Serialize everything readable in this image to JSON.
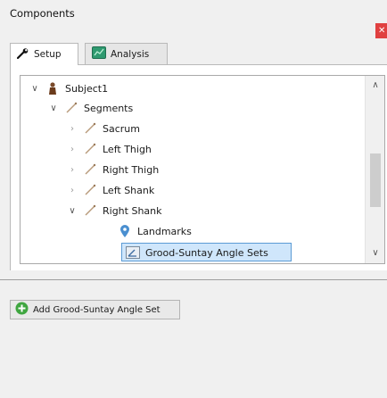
{
  "panel": {
    "title": "Components"
  },
  "tabs": [
    {
      "label": "Setup",
      "icon": "wrench-icon",
      "active": true
    },
    {
      "label": "Analysis",
      "icon": "analysis-icon",
      "active": false
    }
  ],
  "tree": {
    "items": [
      {
        "label": "Subject1",
        "icon": "subject-icon",
        "expanded": true
      },
      {
        "label": "Segments",
        "icon": "segment-icon",
        "expanded": true
      },
      {
        "label": "Sacrum",
        "icon": "segment-icon",
        "expanded": false
      },
      {
        "label": "Left Thigh",
        "icon": "segment-icon",
        "expanded": false
      },
      {
        "label": "Right Thigh",
        "icon": "segment-icon",
        "expanded": false
      },
      {
        "label": "Left Shank",
        "icon": "segment-icon",
        "expanded": false
      },
      {
        "label": "Right Shank",
        "icon": "segment-icon",
        "expanded": true
      },
      {
        "label": "Landmarks",
        "icon": "landmark-pin-icon"
      },
      {
        "label": "Grood-Suntay Angle Sets",
        "icon": "angle-set-icon",
        "selected": true
      }
    ]
  },
  "actions": {
    "add_label": "Add Grood-Suntay Angle Set"
  },
  "colors": {
    "selection_fill": "#cfe6fb",
    "selection_border": "#5b9bd5",
    "add_icon": "#3fa640"
  }
}
